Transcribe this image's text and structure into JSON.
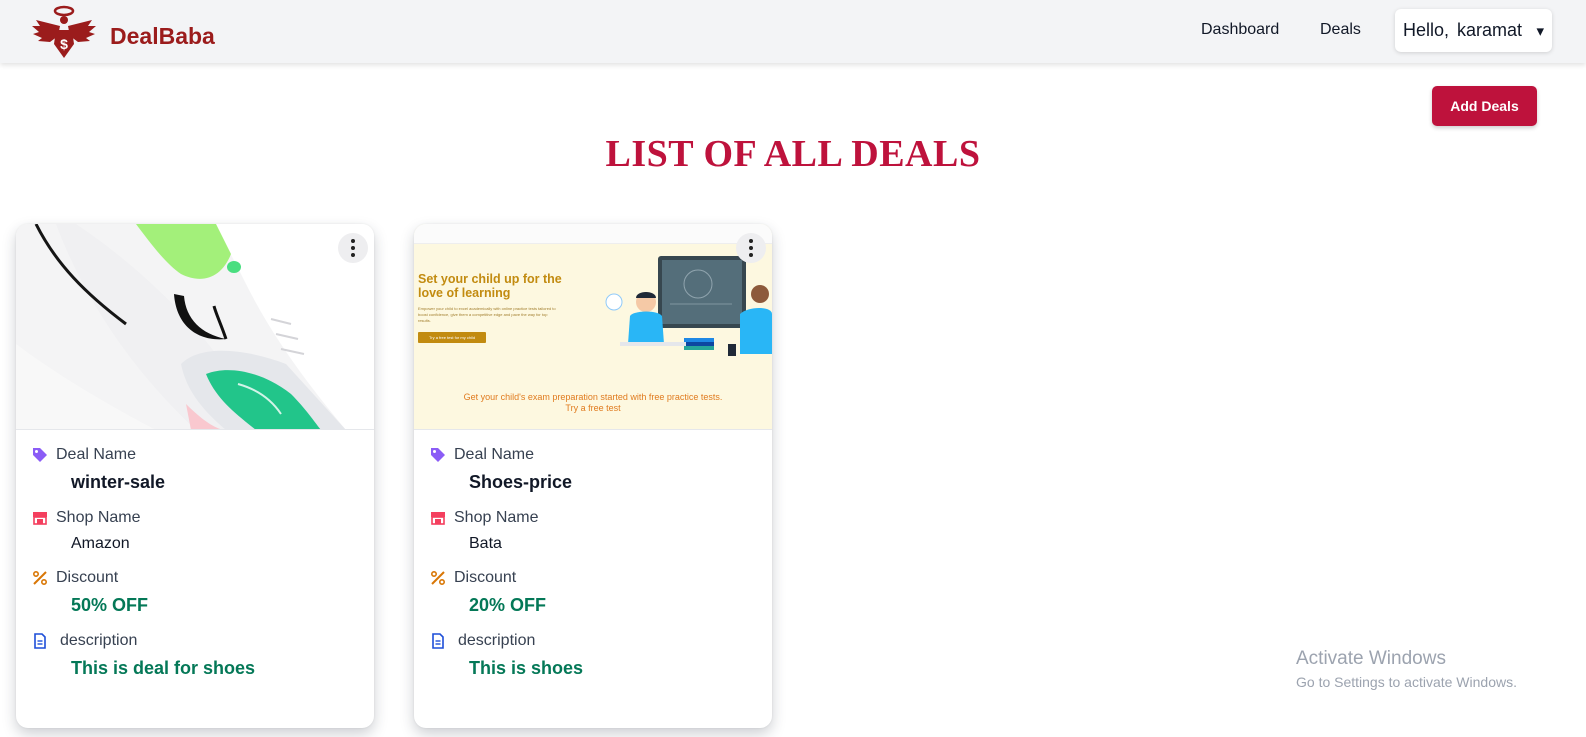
{
  "navbar": {
    "brand": "DealBaba",
    "links": [
      "Dashboard",
      "Deals"
    ],
    "greeting": "Hello,",
    "username": "karamat",
    "caret": "▾"
  },
  "actions": {
    "add_deals": "Add Deals"
  },
  "page": {
    "title": "LIST OF ALL DEALS"
  },
  "deals": [
    {
      "image": "shoe-photo",
      "deal_name_label": "Deal Name",
      "deal_name": "winter-sale",
      "shop_name_label": "Shop Name",
      "shop_name": "Amazon",
      "discount_label": "Discount",
      "discount": "50% OFF",
      "description_label": "description",
      "description": "This is deal for shoes"
    },
    {
      "image": "learning-banner",
      "banner": {
        "title": "Set your child up for the love of learning",
        "body": "Empower your child to excel academically with online practice tests tailored to boost confidence, give them a competitive edge and pave the way for top results.",
        "button": "Try a free test for my child",
        "footer_line1": "Get your child's exam preparation started with free practice tests.",
        "footer_line2": "Try a free test"
      },
      "deal_name_label": "Deal Name",
      "deal_name": "Shoes-price",
      "shop_name_label": "Shop Name",
      "shop_name": "Bata",
      "discount_label": "Discount",
      "discount": "20% OFF",
      "description_label": "description",
      "description": "This is shoes"
    }
  ],
  "icons": {
    "deal_name": "tag-icon",
    "shop_name": "store-icon",
    "discount": "percent-icon",
    "description": "document-icon",
    "menu": "kebab-menu-icon"
  },
  "colors": {
    "brand": "#9b1c1c",
    "accent": "#be123c",
    "value_green": "#047857",
    "tag_icon": "#8b5cf6",
    "store_icon": "#f43f5e",
    "percent_icon": "#d97706",
    "document_icon": "#1d4ed8"
  },
  "watermark": {
    "line1": "Activate Windows",
    "line2": "Go to Settings to activate Windows."
  }
}
